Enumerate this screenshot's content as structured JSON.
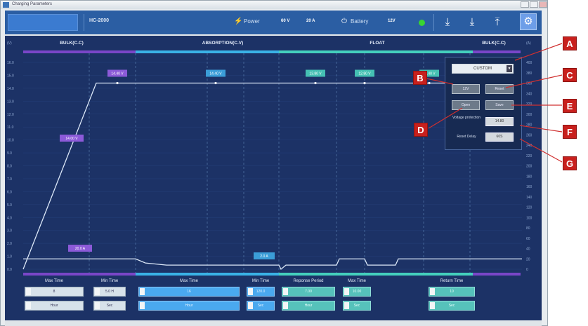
{
  "window": {
    "title": "Charging Parameters"
  },
  "toolbar": {
    "model": "HC-2000",
    "power_label": "Power",
    "power_voltage": "60 V",
    "power_current": "20 A",
    "battery_label": "Battery",
    "battery_voltage": "12V",
    "status_color": "#39d431",
    "accent": "#2b5ea3",
    "buttons": [
      "download-icon",
      "upload-icon",
      "export-icon",
      "settings-icon"
    ]
  },
  "chart_data": {
    "type": "line",
    "left_axis": {
      "ticks": [
        "16.0",
        "15.0",
        "14.0",
        "13.0",
        "12.0",
        "11.0",
        "10.0",
        "9.0",
        "8.0",
        "7.0",
        "6.0",
        "5.0",
        "4.0",
        "3.0",
        "2.0",
        "1.0",
        "0.0"
      ]
    },
    "right_axis": {
      "ticks": [
        "400",
        "380",
        "360",
        "340",
        "320",
        "300",
        "280",
        "260",
        "240",
        "220",
        "200",
        "180",
        "160",
        "140",
        "120",
        "100",
        "80",
        "60",
        "40",
        "20",
        "0"
      ]
    },
    "phases": [
      "BULK(C.C)",
      "ABSORPTION(C.V)",
      "FLOAT",
      "BULK(C.C)"
    ],
    "phase_colors": {
      "bulk": "#7a46c8",
      "absorption": "#3ab2e6",
      "float": "#44d0bd"
    },
    "point_labels": [
      {
        "text": "14.40 V",
        "color": "#8c5ad8"
      },
      {
        "text": "14.40 V",
        "color": "#3b9ed8"
      },
      {
        "text": "13.80 V",
        "color": "#45c0b3"
      },
      {
        "text": "12.80 V",
        "color": "#45c0b3"
      },
      {
        "text": "14.40 V",
        "color": "#45c0b3"
      }
    ],
    "voltage_label": {
      "text": "14.00 V",
      "color": "#8c5ad8"
    },
    "current_labels": [
      {
        "text": "20.0 A",
        "color": "#8c5ad8"
      },
      {
        "text": "2.0 A",
        "color": "#3b9ed8"
      }
    ],
    "voltage_curve_v": [
      0.0,
      14.4,
      14.4,
      14.4,
      14.4
    ],
    "current_curve_a": [
      20.0,
      20.0,
      18.0,
      2.0,
      0.0
    ]
  },
  "panel": {
    "profile_select": "CUSTOM",
    "btn_12v": "12V",
    "btn_reset": "Reset",
    "btn_open": "Open",
    "btn_save": "Save",
    "voltage_protection_label": "Voltage protection",
    "voltage_protection_value": "14.80",
    "reset_delay_label": "Reset Delay",
    "reset_delay_value": "60S"
  },
  "callouts": [
    "A",
    "B",
    "C",
    "D",
    "E",
    "F",
    "G"
  ],
  "controls": [
    {
      "title": "Max Time",
      "values": [
        "8",
        "Hour"
      ],
      "style": "light"
    },
    {
      "title": "Min Time",
      "values": [
        "5.0 H",
        "Sec"
      ],
      "style": "light"
    },
    {
      "title": "Max Time",
      "values": [
        "16",
        "Hour"
      ],
      "style": "blue"
    },
    {
      "title": "Min Time",
      "values": [
        "120.0",
        "Sec"
      ],
      "style": "blue"
    },
    {
      "title": "Reponse Period",
      "values": [
        "7.00",
        "Hour"
      ],
      "style": "teal"
    },
    {
      "title": "Max Time",
      "values": [
        "10.00",
        "Sec"
      ],
      "style": "teal"
    },
    {
      "title": "Return Time",
      "values": [
        "10",
        "Sec"
      ],
      "style": "teal"
    }
  ]
}
